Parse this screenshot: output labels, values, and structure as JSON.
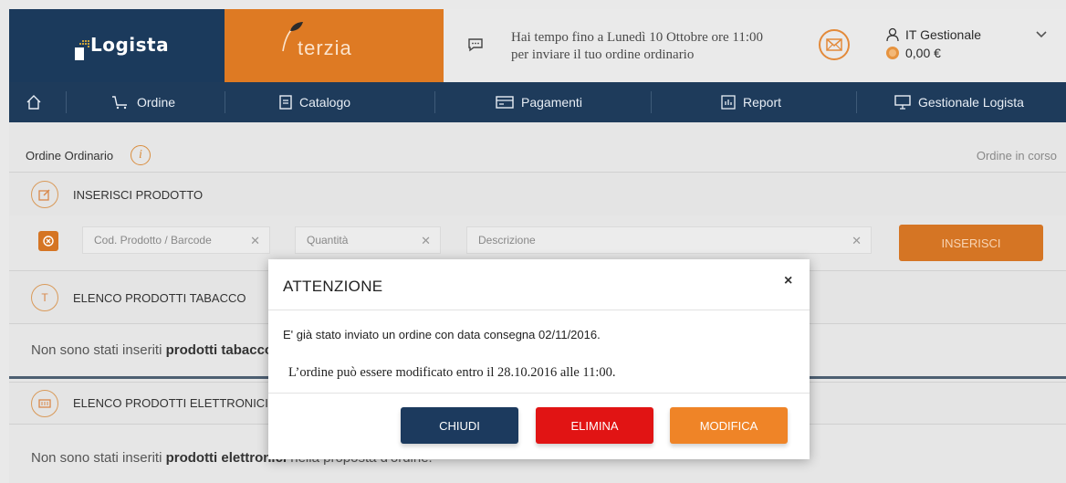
{
  "header": {
    "brand_logista": "Logista",
    "brand_terzia": "terzia",
    "notice_line1": "Hai tempo fino a Lunedì 10 Ottobre ore 11:00",
    "notice_line2": "per inviare il tuo ordine ordinario",
    "user_name": "IT Gestionale",
    "balance": "0,00 €"
  },
  "nav": {
    "items": [
      {
        "label": "Ordine",
        "icon": "cart-icon"
      },
      {
        "label": "Catalogo",
        "icon": "catalog-icon"
      },
      {
        "label": "Pagamenti",
        "icon": "card-icon"
      },
      {
        "label": "Report",
        "icon": "report-icon"
      },
      {
        "label": "Gestionale Logista",
        "icon": "monitor-icon"
      }
    ]
  },
  "page": {
    "title": "Ordine Ordinario",
    "status": "Ordine in corso"
  },
  "insert": {
    "section_title": "INSERISCI PRODOTTO",
    "code_placeholder": "Cod. Prodotto / Barcode",
    "qty_placeholder": "Quantità",
    "desc_placeholder": "Descrizione",
    "button_label": "INSERISCI"
  },
  "tobacco": {
    "section_title": "ELENCO PRODOTTI TABACCO",
    "icon_letter": "T",
    "empty_prefix": "Non sono stati inseriti",
    "empty_bold": "prodotti tabacco"
  },
  "electronic": {
    "section_title": "ELENCO PRODOTTI ELETTRONICI",
    "empty_prefix": "Non sono stati inseriti",
    "empty_bold": "prodotti elettronici",
    "empty_suffix": "nella proposta d'ordine."
  },
  "modal": {
    "title": "ATTENZIONE",
    "close_symbol": "×",
    "line1": "E' già stato inviato un ordine con data consegna 02/11/2016.",
    "line2": "L’ordine può essere modificato entro il 28.10.2016 alle 11:00.",
    "btn_close": "CHIUDI",
    "btn_delete": "ELIMINA",
    "btn_edit": "MODIFICA"
  },
  "colors": {
    "navy": "#1c3a5e",
    "orange": "#ef8427",
    "red": "#e11414"
  }
}
